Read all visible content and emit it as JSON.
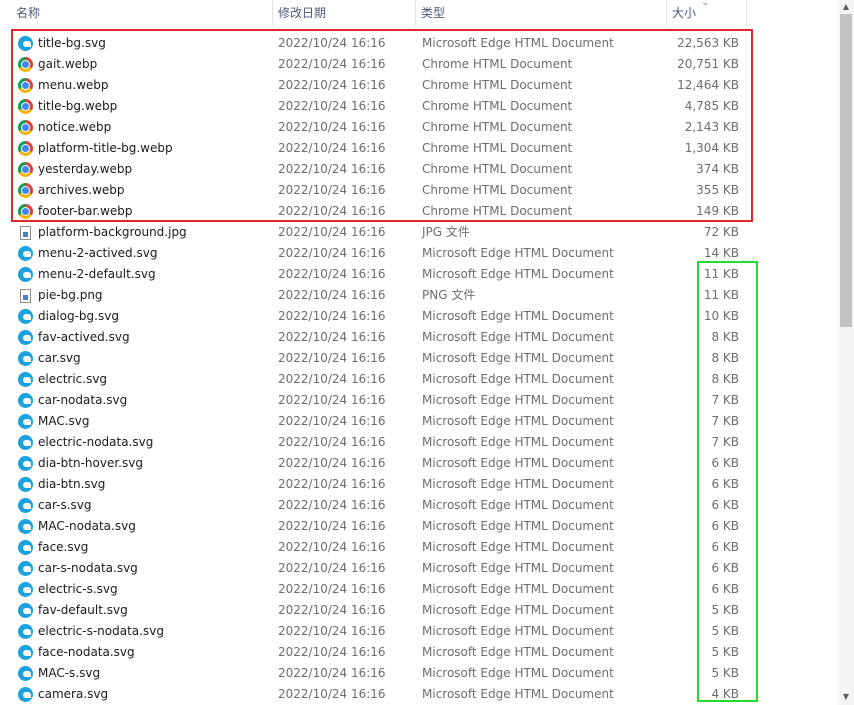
{
  "columns": {
    "name": "名称",
    "date": "修改日期",
    "type": "类型",
    "size": "大小"
  },
  "sort_indicator": "chevron-up-icon",
  "colors": {
    "highlight_red": "#e0262d",
    "highlight_green": "#27d930"
  },
  "files": [
    {
      "name": "title-bg.svg",
      "date": "2022/10/24 16:16",
      "type": "Microsoft Edge HTML Document",
      "size": "22,563 KB",
      "icon": "edge-icon"
    },
    {
      "name": "gait.webp",
      "date": "2022/10/24 16:16",
      "type": "Chrome HTML Document",
      "size": "20,751 KB",
      "icon": "chrome-icon"
    },
    {
      "name": "menu.webp",
      "date": "2022/10/24 16:16",
      "type": "Chrome HTML Document",
      "size": "12,464 KB",
      "icon": "chrome-icon"
    },
    {
      "name": "title-bg.webp",
      "date": "2022/10/24 16:16",
      "type": "Chrome HTML Document",
      "size": "4,785 KB",
      "icon": "chrome-icon"
    },
    {
      "name": "notice.webp",
      "date": "2022/10/24 16:16",
      "type": "Chrome HTML Document",
      "size": "2,143 KB",
      "icon": "chrome-icon"
    },
    {
      "name": "platform-title-bg.webp",
      "date": "2022/10/24 16:16",
      "type": "Chrome HTML Document",
      "size": "1,304 KB",
      "icon": "chrome-icon"
    },
    {
      "name": "yesterday.webp",
      "date": "2022/10/24 16:16",
      "type": "Chrome HTML Document",
      "size": "374 KB",
      "icon": "chrome-icon"
    },
    {
      "name": "archives.webp",
      "date": "2022/10/24 16:16",
      "type": "Chrome HTML Document",
      "size": "355 KB",
      "icon": "chrome-icon"
    },
    {
      "name": "footer-bar.webp",
      "date": "2022/10/24 16:16",
      "type": "Chrome HTML Document",
      "size": "149 KB",
      "icon": "chrome-icon"
    },
    {
      "name": "platform-background.jpg",
      "date": "2022/10/24 16:16",
      "type": "JPG 文件",
      "size": "72 KB",
      "icon": "image-file-icon"
    },
    {
      "name": "menu-2-actived.svg",
      "date": "2022/10/24 16:16",
      "type": "Microsoft Edge HTML Document",
      "size": "14 KB",
      "icon": "edge-icon"
    },
    {
      "name": "menu-2-default.svg",
      "date": "2022/10/24 16:16",
      "type": "Microsoft Edge HTML Document",
      "size": "11 KB",
      "icon": "edge-icon"
    },
    {
      "name": "pie-bg.png",
      "date": "2022/10/24 16:16",
      "type": "PNG 文件",
      "size": "11 KB",
      "icon": "image-file-icon"
    },
    {
      "name": "dialog-bg.svg",
      "date": "2022/10/24 16:16",
      "type": "Microsoft Edge HTML Document",
      "size": "10 KB",
      "icon": "edge-icon"
    },
    {
      "name": "fav-actived.svg",
      "date": "2022/10/24 16:16",
      "type": "Microsoft Edge HTML Document",
      "size": "8 KB",
      "icon": "edge-icon"
    },
    {
      "name": "car.svg",
      "date": "2022/10/24 16:16",
      "type": "Microsoft Edge HTML Document",
      "size": "8 KB",
      "icon": "edge-icon"
    },
    {
      "name": "electric.svg",
      "date": "2022/10/24 16:16",
      "type": "Microsoft Edge HTML Document",
      "size": "8 KB",
      "icon": "edge-icon"
    },
    {
      "name": "car-nodata.svg",
      "date": "2022/10/24 16:16",
      "type": "Microsoft Edge HTML Document",
      "size": "7 KB",
      "icon": "edge-icon"
    },
    {
      "name": "MAC.svg",
      "date": "2022/10/24 16:16",
      "type": "Microsoft Edge HTML Document",
      "size": "7 KB",
      "icon": "edge-icon"
    },
    {
      "name": "electric-nodata.svg",
      "date": "2022/10/24 16:16",
      "type": "Microsoft Edge HTML Document",
      "size": "7 KB",
      "icon": "edge-icon"
    },
    {
      "name": "dia-btn-hover.svg",
      "date": "2022/10/24 16:16",
      "type": "Microsoft Edge HTML Document",
      "size": "6 KB",
      "icon": "edge-icon"
    },
    {
      "name": "dia-btn.svg",
      "date": "2022/10/24 16:16",
      "type": "Microsoft Edge HTML Document",
      "size": "6 KB",
      "icon": "edge-icon"
    },
    {
      "name": "car-s.svg",
      "date": "2022/10/24 16:16",
      "type": "Microsoft Edge HTML Document",
      "size": "6 KB",
      "icon": "edge-icon"
    },
    {
      "name": "MAC-nodata.svg",
      "date": "2022/10/24 16:16",
      "type": "Microsoft Edge HTML Document",
      "size": "6 KB",
      "icon": "edge-icon"
    },
    {
      "name": "face.svg",
      "date": "2022/10/24 16:16",
      "type": "Microsoft Edge HTML Document",
      "size": "6 KB",
      "icon": "edge-icon"
    },
    {
      "name": "car-s-nodata.svg",
      "date": "2022/10/24 16:16",
      "type": "Microsoft Edge HTML Document",
      "size": "6 KB",
      "icon": "edge-icon"
    },
    {
      "name": "electric-s.svg",
      "date": "2022/10/24 16:16",
      "type": "Microsoft Edge HTML Document",
      "size": "6 KB",
      "icon": "edge-icon"
    },
    {
      "name": "fav-default.svg",
      "date": "2022/10/24 16:16",
      "type": "Microsoft Edge HTML Document",
      "size": "5 KB",
      "icon": "edge-icon"
    },
    {
      "name": "electric-s-nodata.svg",
      "date": "2022/10/24 16:16",
      "type": "Microsoft Edge HTML Document",
      "size": "5 KB",
      "icon": "edge-icon"
    },
    {
      "name": "face-nodata.svg",
      "date": "2022/10/24 16:16",
      "type": "Microsoft Edge HTML Document",
      "size": "5 KB",
      "icon": "edge-icon"
    },
    {
      "name": "MAC-s.svg",
      "date": "2022/10/24 16:16",
      "type": "Microsoft Edge HTML Document",
      "size": "5 KB",
      "icon": "edge-icon"
    },
    {
      "name": "camera.svg",
      "date": "2022/10/24 16:16",
      "type": "Microsoft Edge HTML Document",
      "size": "4 KB",
      "icon": "edge-icon"
    }
  ]
}
